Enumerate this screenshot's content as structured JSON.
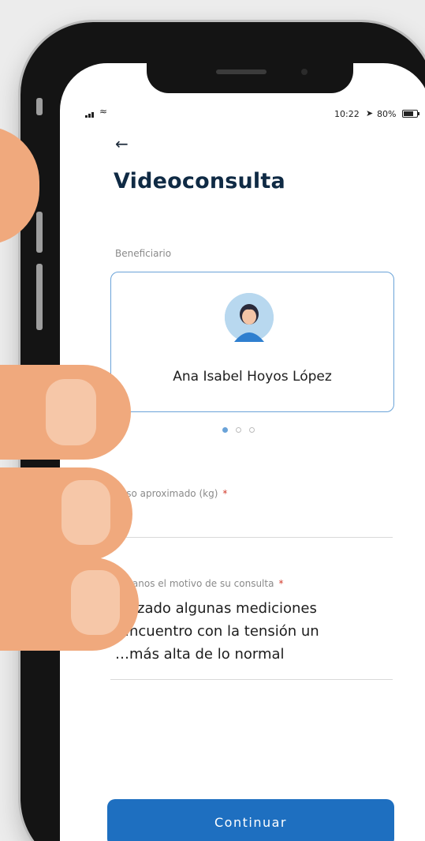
{
  "status_bar": {
    "time": "10:22",
    "battery": "80%",
    "location_icon": "location-arrow",
    "wifi_icon": "wifi"
  },
  "header": {
    "back_icon": "back-arrow",
    "title": "Videoconsulta"
  },
  "beneficiary": {
    "label": "Beneficiario",
    "name": "Ana Isabel Hoyos López",
    "carousel_page": 1,
    "carousel_total": 3
  },
  "weight_field": {
    "label": "Peso aproximado (kg)",
    "required_mark": "*",
    "value": ""
  },
  "reason_field": {
    "label": "…icanos el motivo de su consulta",
    "required_mark": "*",
    "value_lines": [
      "…lizado algunas mediciones",
      "…ncuentro con la tensión un",
      "…más alta de lo normal"
    ]
  },
  "continue_button": {
    "label": "Continuar"
  },
  "colors": {
    "brand_blue": "#1e6fc0",
    "title": "#0f2a44",
    "card_border": "#6aa3d8",
    "required": "#d23a2a"
  }
}
